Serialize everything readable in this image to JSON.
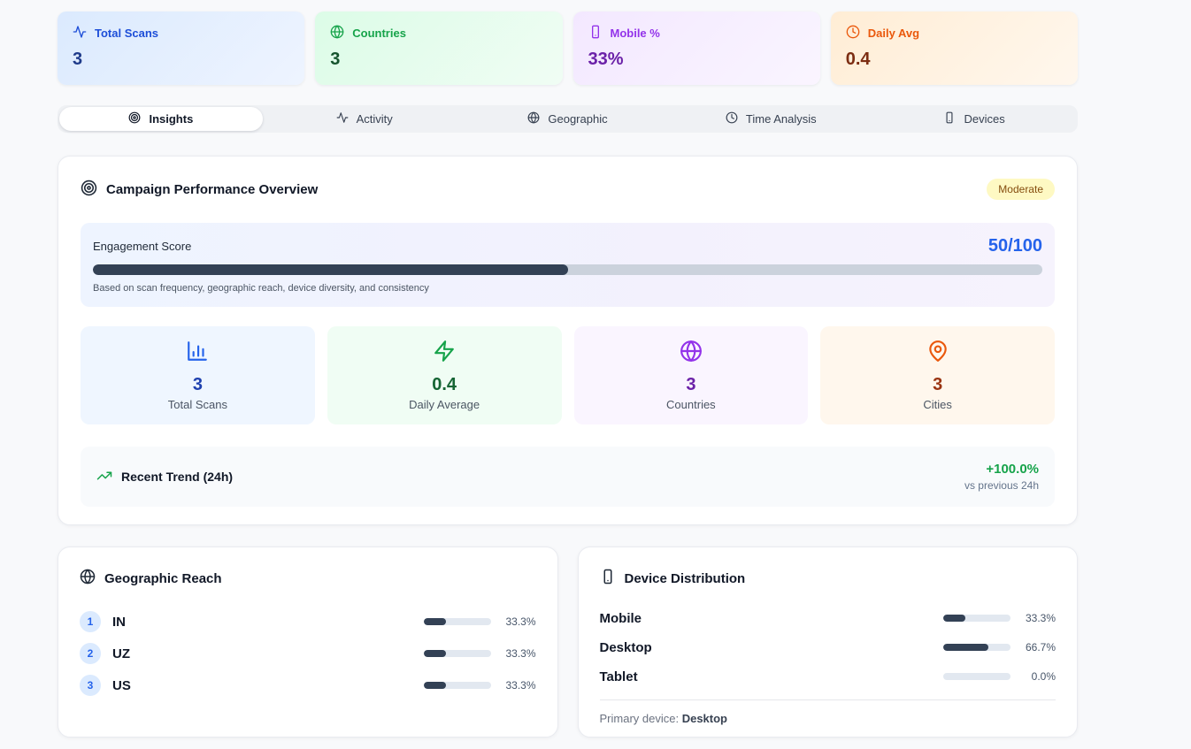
{
  "colors": {
    "accent_blue": "#2563eb",
    "accent_green": "#16a34a",
    "accent_purple": "#9333ea",
    "accent_orange": "#ea580c",
    "score_bar_fill": "#334155",
    "badge_bg": "#fef9c3",
    "badge_text": "#854d0e",
    "trend_green": "#16a34a"
  },
  "stat_cards": [
    {
      "label": "Total Scans",
      "value": "3",
      "icon": "activity-icon"
    },
    {
      "label": "Countries",
      "value": "3",
      "icon": "globe-icon"
    },
    {
      "label": "Mobile %",
      "value": "33%",
      "icon": "smartphone-icon"
    },
    {
      "label": "Daily Avg",
      "value": "0.4",
      "icon": "clock-icon"
    }
  ],
  "tabs": [
    {
      "label": "Insights",
      "icon": "target-icon",
      "active": true
    },
    {
      "label": "Activity",
      "icon": "activity-icon",
      "active": false
    },
    {
      "label": "Geographic",
      "icon": "globe-icon",
      "active": false
    },
    {
      "label": "Time Analysis",
      "icon": "clock-icon",
      "active": false
    },
    {
      "label": "Devices",
      "icon": "smartphone-icon",
      "active": false
    }
  ],
  "overview": {
    "title": "Campaign Performance Overview",
    "badge": "Moderate",
    "engagement": {
      "label": "Engagement Score",
      "score": "50/100",
      "percent": 50,
      "caption": "Based on scan frequency, geographic reach, device diversity, and consistency"
    },
    "mini_stats": [
      {
        "value": "3",
        "label": "Total Scans",
        "icon": "bar-chart-icon"
      },
      {
        "value": "0.4",
        "label": "Daily Average",
        "icon": "zap-icon"
      },
      {
        "value": "3",
        "label": "Countries",
        "icon": "globe-icon"
      },
      {
        "value": "3",
        "label": "Cities",
        "icon": "map-pin-icon"
      }
    ],
    "trend": {
      "label": "Recent Trend (24h)",
      "value": "+100.0%",
      "sub": "vs previous 24h"
    }
  },
  "geographic": {
    "title": "Geographic Reach",
    "rows": [
      {
        "rank": "1",
        "code": "IN",
        "pct": "33.3%",
        "pct_num": 33.3
      },
      {
        "rank": "2",
        "code": "UZ",
        "pct": "33.3%",
        "pct_num": 33.3
      },
      {
        "rank": "3",
        "code": "US",
        "pct": "33.3%",
        "pct_num": 33.3
      }
    ]
  },
  "devices": {
    "title": "Device Distribution",
    "rows": [
      {
        "label": "Mobile",
        "pct": "33.3%",
        "pct_num": 33.3
      },
      {
        "label": "Desktop",
        "pct": "66.7%",
        "pct_num": 66.7
      },
      {
        "label": "Tablet",
        "pct": "0.0%",
        "pct_num": 0
      }
    ],
    "primary_label": "Primary device:",
    "primary_value": "Desktop"
  }
}
